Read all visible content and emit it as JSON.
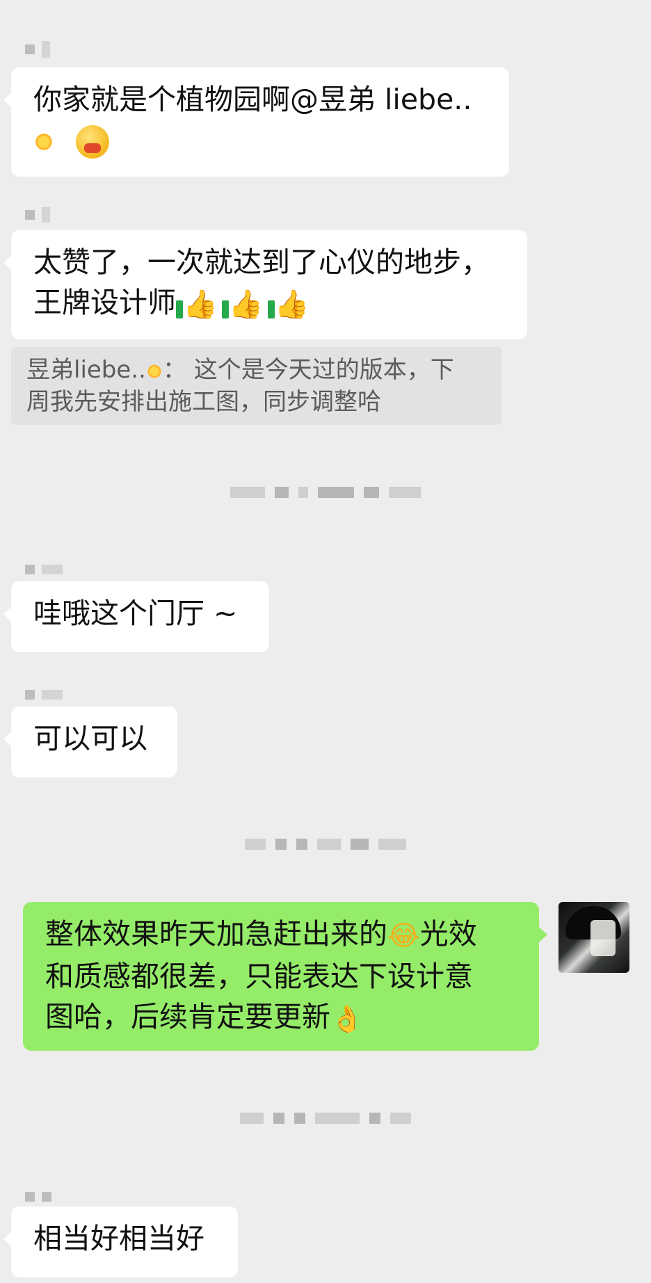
{
  "messages": [
    {
      "id": "m1",
      "side": "left",
      "lines": [
        "你家就是个植物园啊@昱弟 liebe..",
        ""
      ],
      "emoji": [
        "sun-icon",
        "heart-face-icon"
      ]
    },
    {
      "id": "m2",
      "side": "left",
      "lines": [
        "太赞了，一次就达到了心仪的地步，",
        "王牌设计师"
      ],
      "emoji": [
        "thumbs-up-icon",
        "thumbs-up-icon",
        "thumbs-up-icon"
      ],
      "quote": {
        "lines": [
          "昱弟liebe..",
          "：  这个是今天过的版本，下",
          "周我先安排出施工图，同步调整哈"
        ]
      }
    },
    {
      "id": "m3",
      "side": "left",
      "lines": [
        "哇哦这个门厅 ~"
      ]
    },
    {
      "id": "m4",
      "side": "left",
      "lines": [
        "可以可以"
      ]
    },
    {
      "id": "m5",
      "side": "right",
      "lines": [
        "整体效果昨天加急赶出来的",
        "光效",
        "和质感都很差，只能表达下设计意",
        "图哈，后续肯定要更新"
      ],
      "emoji": [
        "laughing-tears-icon",
        "ok-hand-icon"
      ]
    },
    {
      "id": "m6",
      "side": "left",
      "lines": [
        "相当好相当好"
      ]
    }
  ],
  "glyphs": {
    "thumb": "👍",
    "laugh": "😂",
    "okhand": "👌"
  },
  "colors": {
    "background": "#ededed",
    "bubble_left": "#ffffff",
    "bubble_right": "#95ec69",
    "quote_bg": "#e2e2e2"
  }
}
